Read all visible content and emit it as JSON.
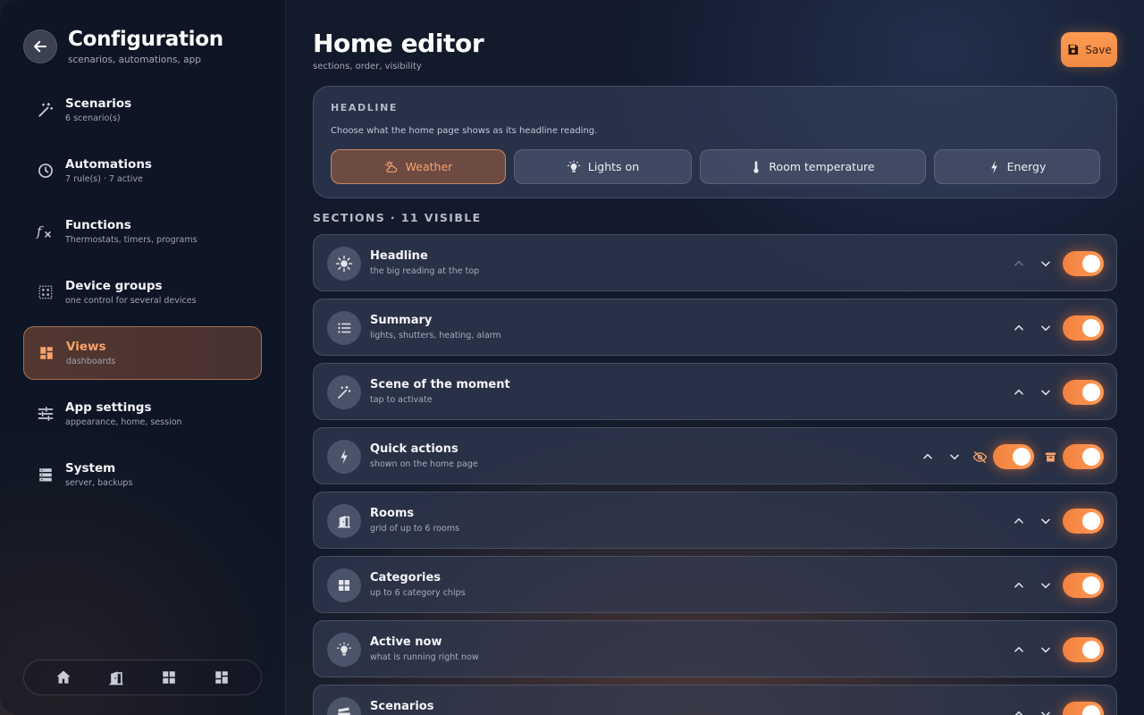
{
  "sidebar": {
    "title": "Configuration",
    "subtitle": "scenarios, automations, app",
    "items": [
      {
        "label": "Scenarios",
        "sub": "6 scenario(s)",
        "icon": "magic-wand-icon"
      },
      {
        "label": "Automations",
        "sub": "7 rule(s) · 7 active",
        "icon": "clock-icon"
      },
      {
        "label": "Functions",
        "sub": "Thermostats, timers, programs",
        "icon": "function-icon"
      },
      {
        "label": "Device groups",
        "sub": "one control for several devices",
        "icon": "grid-dots-icon"
      },
      {
        "label": "Views",
        "sub": "dashboards",
        "icon": "dashboard-icon",
        "active": true
      },
      {
        "label": "App settings",
        "sub": "appearance, home, session",
        "icon": "sliders-icon"
      },
      {
        "label": "System",
        "sub": "server, backups",
        "icon": "server-icon"
      }
    ],
    "bottom_nav": [
      "home-icon",
      "door-icon",
      "grid-icon",
      "dashboard-icon"
    ]
  },
  "main": {
    "title": "Home editor",
    "subtitle": "sections, order, visibility",
    "save_label": "Save",
    "headline": {
      "title": "HEADLINE",
      "description": "Choose what the home page shows as its headline reading.",
      "options": [
        {
          "label": "Weather",
          "icon": "weather-icon",
          "selected": true
        },
        {
          "label": "Lights on",
          "icon": "bulb-icon"
        },
        {
          "label": "Room temperature",
          "icon": "thermometer-icon"
        },
        {
          "label": "Energy",
          "icon": "bolt-icon"
        }
      ]
    },
    "sections_title": "SECTIONS · 11 VISIBLE",
    "sections": [
      {
        "title": "Headline",
        "sub": "the big reading at the top",
        "icon": "sun-icon",
        "enabled": true
      },
      {
        "title": "Summary",
        "sub": "lights, shutters, heating, alarm",
        "icon": "list-icon",
        "enabled": true
      },
      {
        "title": "Scene of the moment",
        "sub": "tap to activate",
        "icon": "magic-wand-icon",
        "enabled": true
      },
      {
        "title": "Quick actions",
        "sub": "shown on the home page",
        "icon": "bolt-icon",
        "enabled": true,
        "hidden_toggle": true
      },
      {
        "title": "Rooms",
        "sub": "grid of up to 6 rooms",
        "icon": "door-icon",
        "enabled": true
      },
      {
        "title": "Categories",
        "sub": "up to 6 category chips",
        "icon": "grid-icon",
        "enabled": true
      },
      {
        "title": "Active now",
        "sub": "what is running right now",
        "icon": "bulb-icon",
        "enabled": true
      },
      {
        "title": "Scenarios",
        "sub": "",
        "icon": "clapper-icon",
        "enabled": true
      }
    ]
  },
  "colors": {
    "accent": "#f6a36a",
    "toggle": "#f2813e",
    "background": "#121a2b"
  }
}
